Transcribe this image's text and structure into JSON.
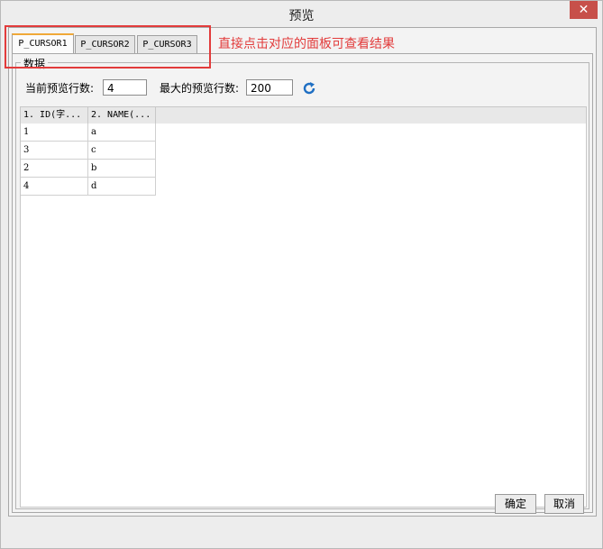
{
  "window": {
    "title": "预览",
    "close_symbol": "✕"
  },
  "tabs": [
    {
      "label": "P_CURSOR1"
    },
    {
      "label": "P_CURSOR2"
    },
    {
      "label": "P_CURSOR3"
    }
  ],
  "annotation": {
    "text": "直接点击对应的面板可查看结果",
    "color": "#e23b3b"
  },
  "group": {
    "title": "数据"
  },
  "preview": {
    "current_label": "当前预览行数:",
    "current_value": "4",
    "max_label": "最大的预览行数:",
    "max_value": "200",
    "refresh_icon": "refresh-icon"
  },
  "grid": {
    "columns": [
      "1. ID(字...",
      "2. NAME(..."
    ],
    "rows": [
      [
        "1",
        "a"
      ],
      [
        "3",
        "c"
      ],
      [
        "2",
        "b"
      ],
      [
        "4",
        "d"
      ]
    ]
  },
  "buttons": {
    "ok": "确定",
    "cancel": "取消"
  }
}
